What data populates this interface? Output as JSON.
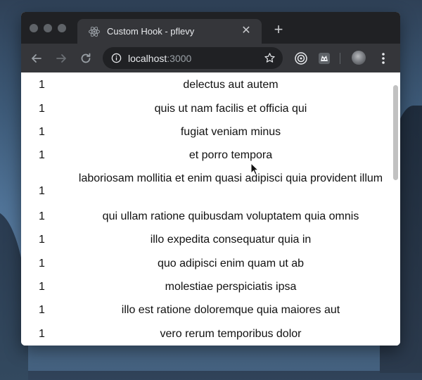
{
  "browser": {
    "tab": {
      "title": "Custom Hook - pflevy",
      "favicon": "react-icon"
    },
    "address_bar": {
      "host": "localhost",
      "port": ":3000"
    },
    "icons": {
      "back": "arrow-left-icon",
      "forward": "arrow-right-icon",
      "reload": "reload-icon",
      "info": "info-icon",
      "bookmark": "star-icon",
      "menu": "more-vert-icon"
    }
  },
  "list": {
    "items": [
      {
        "id": "1",
        "title": "delectus aut autem"
      },
      {
        "id": "1",
        "title": "quis ut nam facilis et officia qui"
      },
      {
        "id": "1",
        "title": "fugiat veniam minus"
      },
      {
        "id": "1",
        "title": "et porro tempora"
      },
      {
        "id": "1",
        "title": "laboriosam mollitia et enim quasi adipisci quia provident illum"
      },
      {
        "id": "1",
        "title": "qui ullam ratione quibusdam voluptatem quia omnis"
      },
      {
        "id": "1",
        "title": "illo expedita consequatur quia in"
      },
      {
        "id": "1",
        "title": "quo adipisci enim quam ut ab"
      },
      {
        "id": "1",
        "title": "molestiae perspiciatis ipsa"
      },
      {
        "id": "1",
        "title": "illo est ratione doloremque quia maiores aut"
      },
      {
        "id": "1",
        "title": "vero rerum temporibus dolor"
      }
    ]
  },
  "colors": {
    "titlebar": "#202124",
    "toolbar": "#35363a",
    "content_bg": "#ffffff",
    "text": "#111111"
  }
}
